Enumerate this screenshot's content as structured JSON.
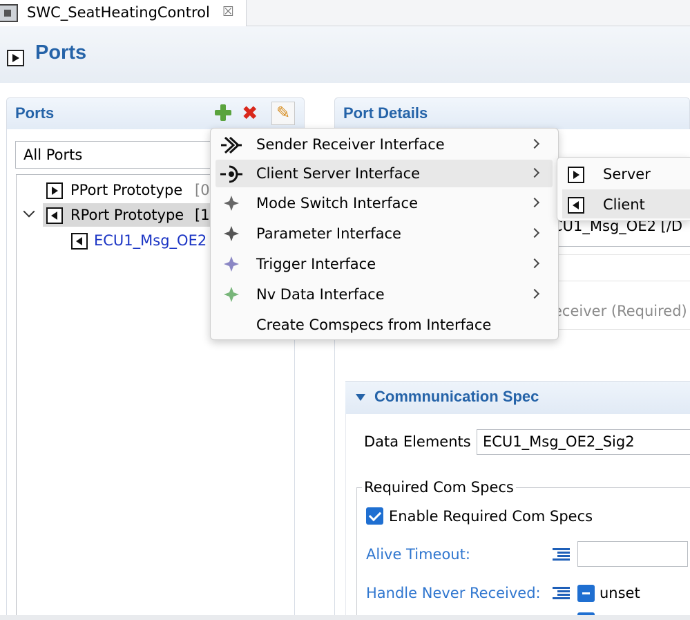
{
  "editor": {
    "tab_title": "SWC_SeatHeatingControl",
    "page_title": "Ports"
  },
  "ports_panel": {
    "title": "Ports",
    "filter": "All Ports",
    "tree": {
      "pport": {
        "label": "PPort Prototype",
        "count": "[0"
      },
      "rport": {
        "label": "RPort Prototype",
        "count": "[1"
      },
      "child": {
        "label": "ECU1_Msg_OE2"
      }
    }
  },
  "details_panel": {
    "title": "Port Details",
    "interface_value": "CU1_Msg_OE2 [/D",
    "kind_value": "eceiver (Required)"
  },
  "comm_spec": {
    "title": "Commnunication Spec",
    "data_elements_label": "Data Elements",
    "data_elements_value": "ECU1_Msg_OE2_Sig2",
    "required_group": {
      "title": "Required Com Specs",
      "enable_label": "Enable Required Com Specs",
      "alive_timeout_label": "Alive Timeout:",
      "handle_never_received_label": "Handle Never Received:",
      "handle_never_received_value": "unset"
    }
  },
  "context_menu": {
    "items": [
      {
        "label": "Sender Receiver Interface",
        "icon": "sender-receiver-icon"
      },
      {
        "label": "Client Server Interface",
        "icon": "client-server-icon"
      },
      {
        "label": "Mode Switch Interface",
        "icon": "mode-switch-icon"
      },
      {
        "label": "Parameter Interface",
        "icon": "parameter-icon"
      },
      {
        "label": "Trigger Interface",
        "icon": "trigger-icon"
      },
      {
        "label": "Nv Data Interface",
        "icon": "nv-data-icon"
      },
      {
        "label": "Create Comspecs from Interface"
      }
    ],
    "submenu": [
      {
        "label": "Server"
      },
      {
        "label": "Client"
      }
    ]
  },
  "colors": {
    "accent": "#2563a8",
    "link": "#1a34c4",
    "field_label": "#2f76cf",
    "check": "#1f6fd1",
    "add": "#5aa33d",
    "delete": "#d9281c"
  }
}
